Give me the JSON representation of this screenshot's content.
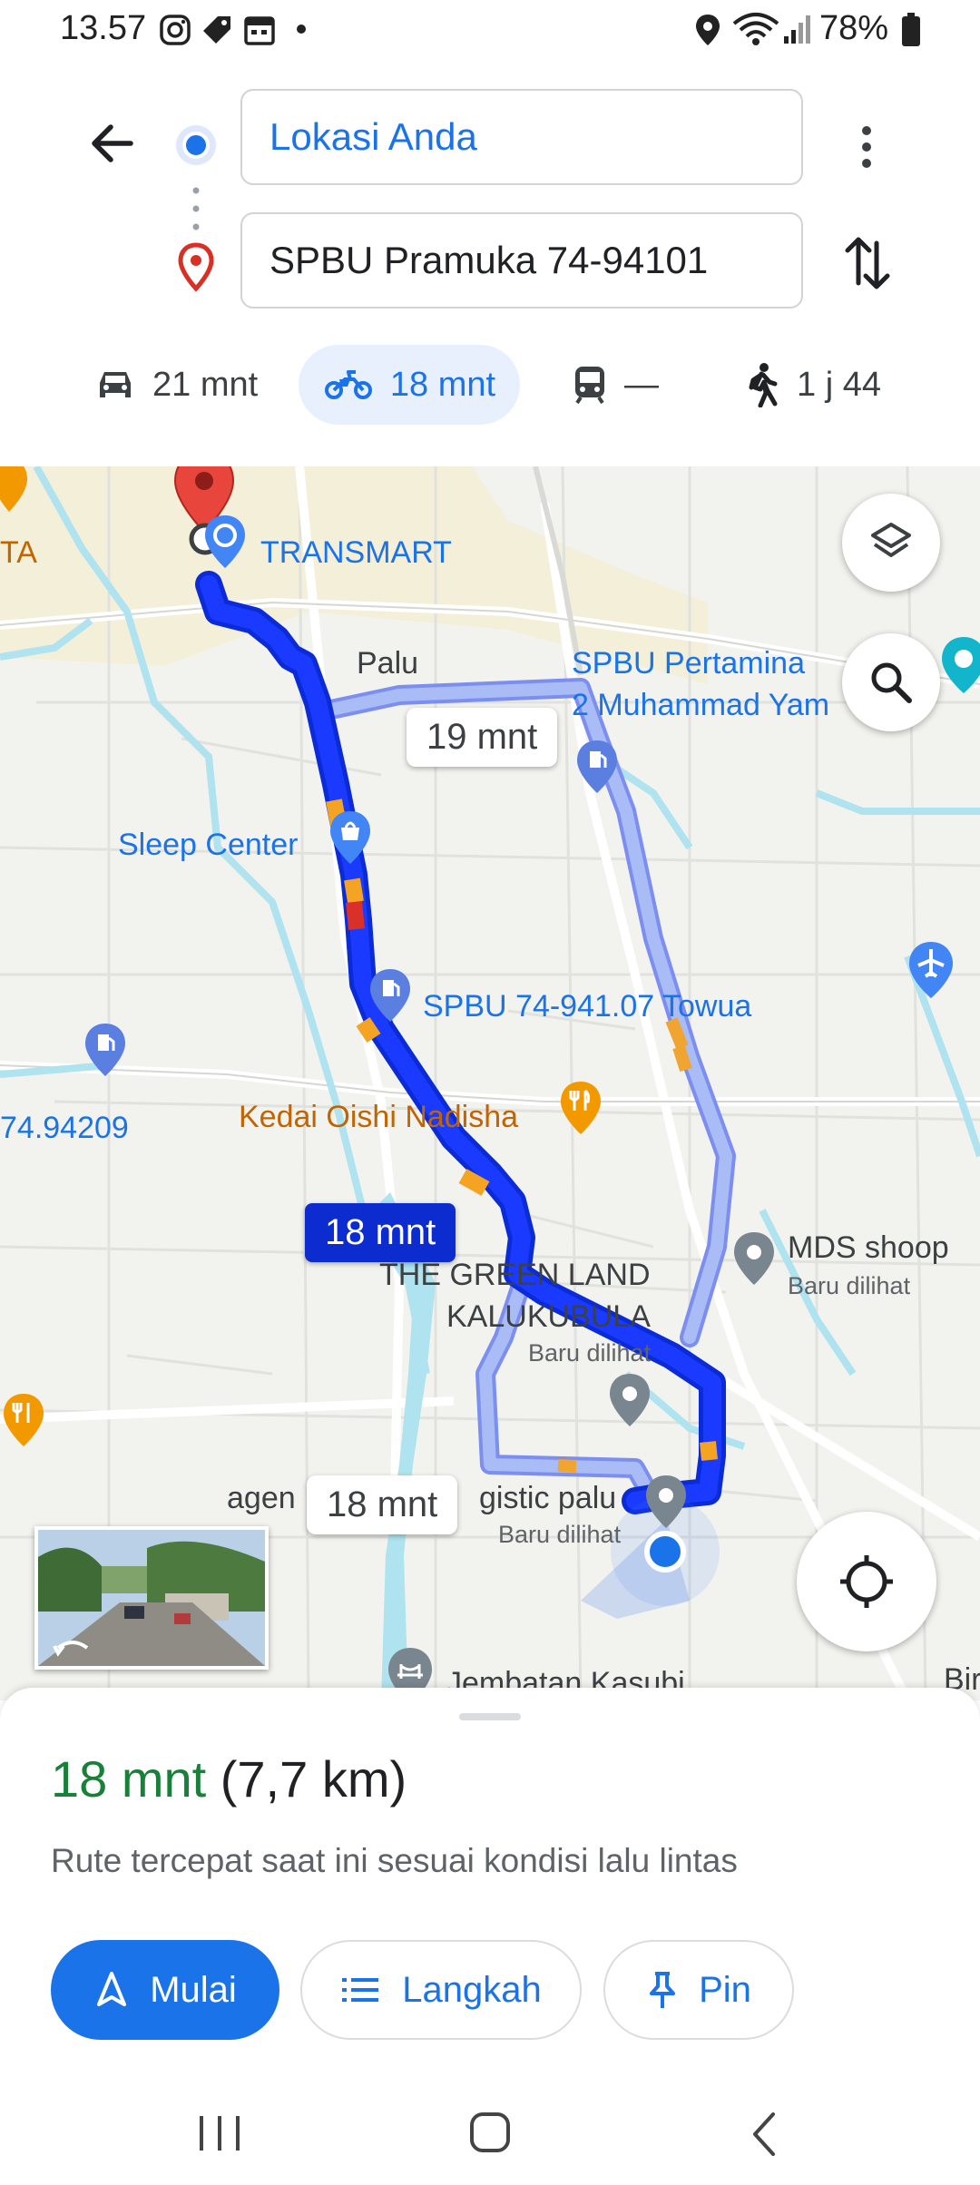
{
  "status_bar": {
    "time": "13.57",
    "battery": "78%",
    "left_icons": [
      "instagram-icon",
      "tag-icon",
      "calendar-icon",
      "dot-icon"
    ],
    "right_icons": [
      "location-icon",
      "wifi-icon",
      "signal-icon",
      "battery-icon"
    ]
  },
  "directions": {
    "origin": "Lokasi Anda",
    "destination": "SPBU Pramuka 74-94101",
    "modes": [
      {
        "icon": "car-icon",
        "label": "21 mnt",
        "selected": false
      },
      {
        "icon": "motorcycle-icon",
        "label": "18 mnt",
        "selected": true
      },
      {
        "icon": "transit-icon",
        "label": "—",
        "selected": false
      },
      {
        "icon": "walk-icon",
        "label": "1 j 44",
        "selected": false
      }
    ]
  },
  "map": {
    "labels": {
      "transmart": "TRANSMART",
      "palu": "Palu",
      "spbu_pertamina": "SPBU Pertamina",
      "muhammad": "2 Muhammad Yam",
      "sleep_center": "Sleep Center",
      "spbu_towua": "SPBU 74-941.07 Towua",
      "kedai": "Kedai Oishi Nadisha",
      "left_code": "74.94209",
      "ta": "TA",
      "mds": "MDS shoop",
      "baru1": "Baru dilihat",
      "green_land_1": "THE GREEN LAND",
      "green_land_2": "KALUKUBULA",
      "baru2": "Baru dilihat",
      "agen": "agen",
      "logistic": "gistic palu",
      "baru3": "Baru dilihat",
      "jembatan": "Jembatan Kasubi",
      "bir": "Bir"
    },
    "route_bubbles": {
      "main": "18 mnt",
      "alt1": "19 mnt",
      "alt2": "18 mnt"
    },
    "colors": {
      "route": "#1a3bff",
      "route_alt": "#a6b8f2",
      "traffic_orange": "#f4a322",
      "traffic_red": "#d9302a",
      "selected_bubble": "#0d2ccf"
    }
  },
  "sheet": {
    "time": "18 mnt",
    "distance": "(7,7 km)",
    "description": "Rute tercepat saat ini sesuai kondisi lalu lintas",
    "buttons": {
      "start": "Mulai",
      "steps": "Langkah",
      "pin": "Pin"
    }
  }
}
